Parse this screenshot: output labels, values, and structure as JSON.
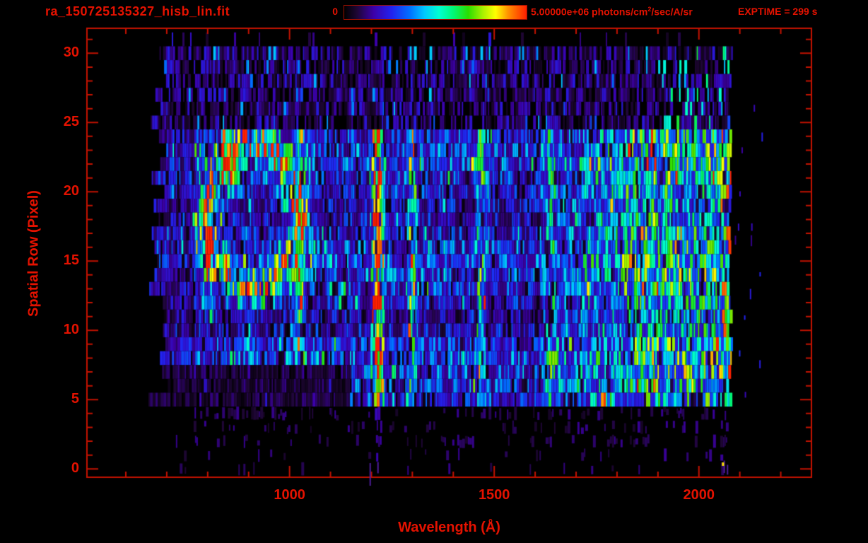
{
  "window": {
    "background": "#000000",
    "accent_red": "#e41200",
    "axis_red": "#c41200"
  },
  "header": {
    "title": "ra_150725135327_hisb_lin.fit",
    "colorbar_min": "0",
    "colorbar_max": "5.00000e+06",
    "units_prefix": " photons/cm",
    "units_sup": "2",
    "units_suffix": "/sec/A/sr",
    "exptime": "EXPTIME = 299 s"
  },
  "chart_data": {
    "type": "heatmap",
    "title": "ra_150725135327_hisb_lin.fit",
    "xlabel": "Wavelength (Å)",
    "ylabel": "Spatial Row (Pixel)",
    "xlim": [
      505,
      2275
    ],
    "ylim": [
      -0.6,
      31.8
    ],
    "x_major_ticks": [
      1000,
      1500,
      2000
    ],
    "x_minor_tick_step": 100,
    "x_minor_tick_range": [
      600,
      2200
    ],
    "y_major_ticks": [
      0,
      5,
      10,
      15,
      20,
      25,
      30
    ],
    "y_minor_tick_step": 1,
    "colorbar": {
      "min": 0,
      "max": 5000000,
      "max_label": "5.00000e+06",
      "units": "photons/cm^2/sec/A/sr"
    },
    "exposure_time_s": 299,
    "data_extent": {
      "wavelength_A": [
        660,
        2078
      ],
      "rows": [
        0,
        31
      ]
    },
    "active_rows": [
      5,
      24
    ],
    "features": [
      {
        "kind": "line",
        "name": "Lyman-alpha-airglow-column",
        "wavelength_A": 1216,
        "sigma_A": 9,
        "rows": [
          5,
          24
        ],
        "strength": 1.0
      },
      {
        "kind": "line",
        "name": "Lyman-beta-airglow-column",
        "wavelength_A": 1026,
        "sigma_A": 7,
        "rows": [
          5,
          24
        ],
        "strength": 0.4
      },
      {
        "kind": "line",
        "name": "OI-1304-airglow-column",
        "wavelength_A": 1300,
        "sigma_A": 7,
        "rows": [
          5,
          24
        ],
        "strength": 0.38
      },
      {
        "kind": "line",
        "name": "cyan-column-1470",
        "wavelength_A": 1470,
        "sigma_A": 9,
        "rows": [
          5,
          24
        ],
        "strength": 0.24
      },
      {
        "kind": "line",
        "name": "cyan-column-1640",
        "wavelength_A": 1640,
        "sigma_A": 14,
        "rows": [
          5,
          24
        ],
        "strength": 0.18
      },
      {
        "kind": "ring",
        "name": "bright-arc-loop",
        "center_wavelength_A": 912,
        "center_row": 18.2,
        "semi_axis_A": 112,
        "semi_axis_rows": 5.2,
        "thickness": 0.16,
        "strength": 0.52
      },
      {
        "kind": "blob",
        "name": "arc-hotspot-top",
        "wavelength_A": 852,
        "row": 21.7,
        "sigma_A": 16,
        "sigma_rows": 1.1,
        "strength": 0.38
      },
      {
        "kind": "blob",
        "name": "arc-hotspot-left",
        "wavelength_A": 800,
        "row": 14.2,
        "sigma_A": 12,
        "sigma_rows": 1.6,
        "strength": 0.3
      },
      {
        "kind": "band",
        "name": "longwave-green-band",
        "wavelength_range_A": [
          1620,
          2078
        ],
        "rows": [
          5,
          24
        ],
        "strength": 0.26
      },
      {
        "kind": "band",
        "name": "blue-continuum",
        "wavelength_range_A": [
          660,
          2078
        ],
        "rows": [
          5,
          24
        ],
        "strength": 0.26
      },
      {
        "kind": "edge",
        "name": "red-edge-stripes",
        "wavelength_range_A": [
          2055,
          2078
        ],
        "rows": [
          5,
          24
        ],
        "strength": 0.92
      }
    ],
    "colormap": [
      [
        0.0,
        "#000000"
      ],
      [
        0.07,
        "#1e0634"
      ],
      [
        0.16,
        "#3c00a8"
      ],
      [
        0.26,
        "#2222ee"
      ],
      [
        0.36,
        "#0070ff"
      ],
      [
        0.44,
        "#00c8ff"
      ],
      [
        0.52,
        "#00ffd2"
      ],
      [
        0.6,
        "#00f874"
      ],
      [
        0.68,
        "#2ade00"
      ],
      [
        0.76,
        "#a8f000"
      ],
      [
        0.83,
        "#ffff00"
      ],
      [
        0.9,
        "#ff9000"
      ],
      [
        1.0,
        "#ff2000"
      ]
    ],
    "grid": false,
    "legend": null
  }
}
